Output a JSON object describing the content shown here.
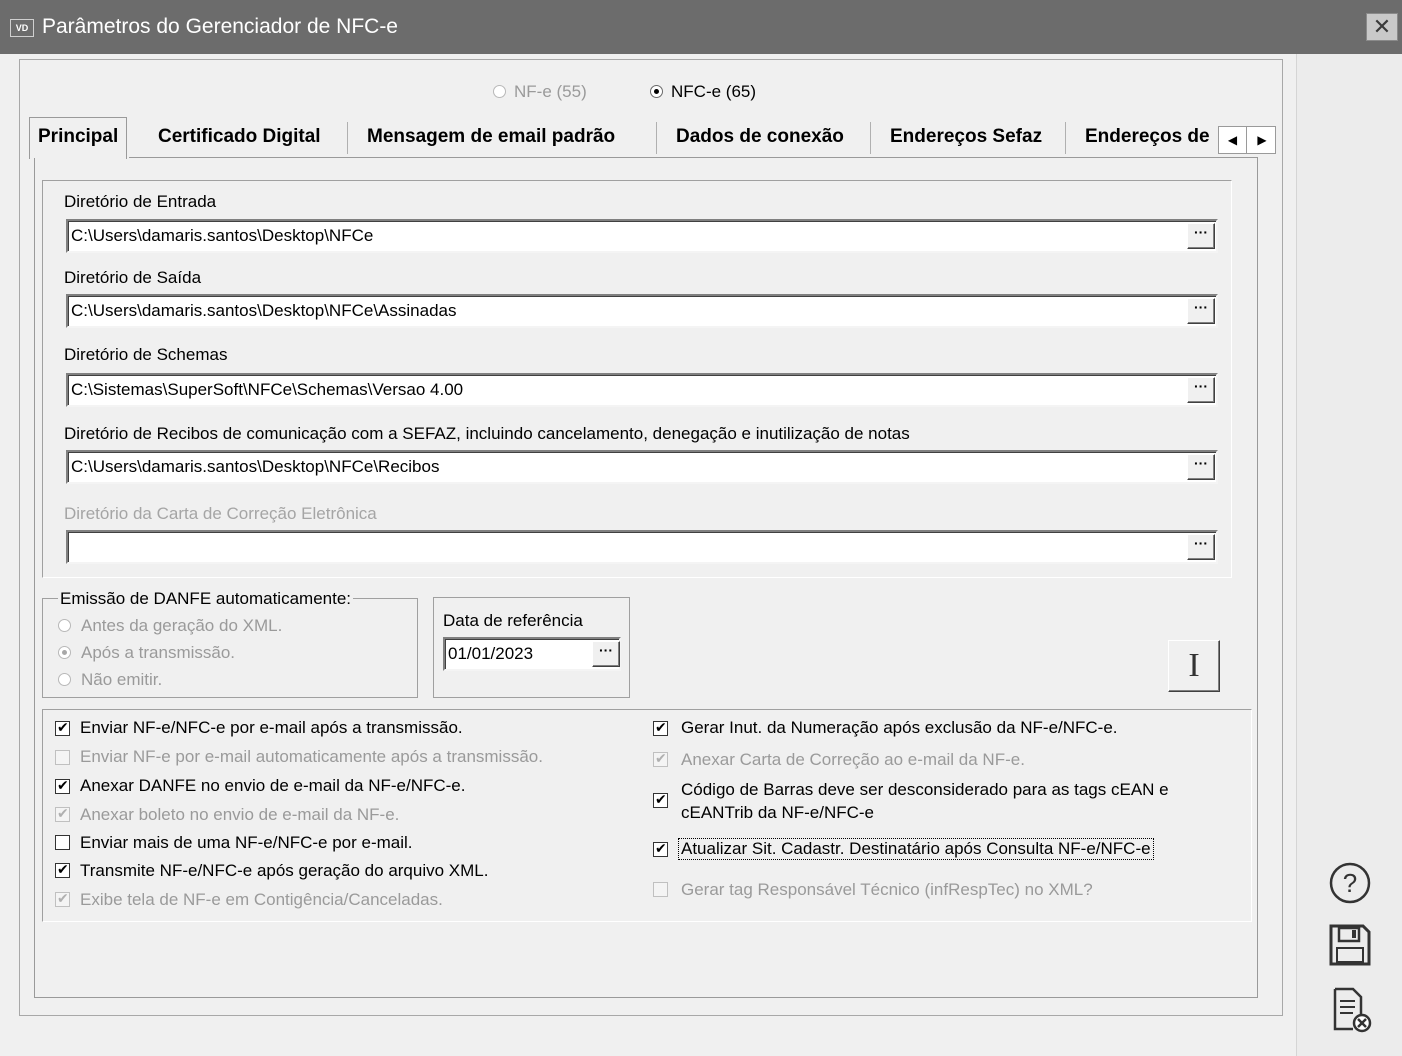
{
  "window": {
    "icon_text": "VD",
    "title": "Parâmetros do Gerenciador de NFC-e",
    "close_glyph": "✕"
  },
  "model": {
    "nfe_label": "NF-e (55)",
    "nfce_label": "NFC-e (65)",
    "selected": "NFC-e (65)"
  },
  "tabs": [
    {
      "label": "Principal",
      "active": true
    },
    {
      "label": "Certificado Digital"
    },
    {
      "label": "Mensagem de email padrão"
    },
    {
      "label": "Dados de conexão"
    },
    {
      "label": "Endereços Sefaz"
    },
    {
      "label": "Endereços de"
    }
  ],
  "directories": {
    "entrada": {
      "label": "Diretório de Entrada",
      "value": "C:\\Users\\damaris.santos\\Desktop\\NFCe"
    },
    "saida": {
      "label": "Diretório de Saída",
      "value": "C:\\Users\\damaris.santos\\Desktop\\NFCe\\Assinadas"
    },
    "schemas": {
      "label": "Diretório de Schemas",
      "value": "C:\\Sistemas\\SuperSoft\\NFCe\\Schemas\\Versao 4.00"
    },
    "recibos": {
      "label": "Diretório de Recibos de comunicação com a SEFAZ, incluindo cancelamento, denegação e inutilização de notas",
      "value": "C:\\Users\\damaris.santos\\Desktop\\NFCe\\Recibos"
    },
    "carta": {
      "label": "Diretório da Carta de Correção Eletrônica",
      "value": ""
    }
  },
  "dots_label": "···",
  "danfe": {
    "title": "Emissão de DANFE automaticamente:",
    "options": [
      "Antes da geração do XML.",
      "Após a transmissão.",
      "Não emitir."
    ],
    "selected": "Após a transmissão."
  },
  "reference_date": {
    "label": "Data de referência",
    "value": "01/01/2023"
  },
  "info_button_label": "I",
  "options_left": [
    {
      "label": "Enviar NF-e/NFC-e por e-mail após a transmissão.",
      "checked": true,
      "enabled": true
    },
    {
      "label": "Enviar NF-e por e-mail automaticamente após a transmissão.",
      "checked": false,
      "enabled": false
    },
    {
      "label": "Anexar DANFE no envio de e-mail da NF-e/NFC-e.",
      "checked": true,
      "enabled": true
    },
    {
      "label": "Anexar boleto no envio de e-mail da NF-e.",
      "checked": true,
      "enabled": false
    },
    {
      "label": "Enviar mais de uma NF-e/NFC-e por e-mail.",
      "checked": false,
      "enabled": true
    },
    {
      "label": "Transmite NF-e/NFC-e após geração do arquivo XML.",
      "checked": true,
      "enabled": true
    },
    {
      "label": "Exibe tela de NF-e em Contigência/Canceladas.",
      "checked": true,
      "enabled": false
    }
  ],
  "options_right": [
    {
      "label": "Gerar Inut. da Numeração após exclusão da NF-e/NFC-e.",
      "checked": true,
      "enabled": true
    },
    {
      "label": "Anexar Carta de Correção ao e-mail da NF-e.",
      "checked": true,
      "enabled": false
    },
    {
      "label": "Código de Barras deve ser desconsiderado para as tags cEAN e",
      "label2": "cEANTrib da NF-e/NFC-e",
      "checked": true,
      "enabled": true
    },
    {
      "label": "Atualizar Sit. Cadastr. Destinatário após Consulta NF-e/NFC-e",
      "checked": true,
      "enabled": true,
      "focused": true
    },
    {
      "label": "Gerar tag Responsável Técnico (infRespTec) no XML?",
      "checked": false,
      "enabled": false
    }
  ],
  "side_icons": [
    "help-icon",
    "save-icon",
    "cancel-document-icon"
  ]
}
